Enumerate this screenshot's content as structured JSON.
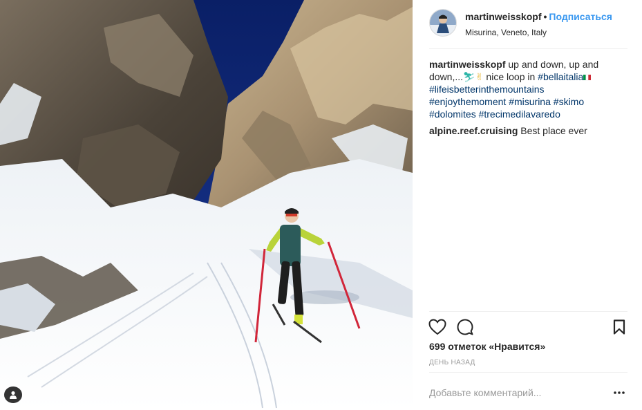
{
  "post": {
    "author": "martinweisskopf",
    "separator": "•",
    "follow_label": "Подписаться",
    "location": "Misurina, Veneto, Italy"
  },
  "caption": {
    "username": "martinweisskopf",
    "text_1": " up and down, up and down,...",
    "emoji_1": "⛷",
    "emoji_2": "✌",
    "text_2": " nice loop in ",
    "hashtags": [
      "#bellaitalia",
      "#lifeisbetterinthemountains",
      "#enjoythemoment",
      "#misurina",
      "#skimo",
      "#dolomites",
      "#trecimedilavaredo"
    ],
    "flag_emoji": "🇮🇹"
  },
  "comment": {
    "username": "alpine.reef.cruising",
    "text": "Best place ever"
  },
  "actions": {
    "like_icon": "heart-icon",
    "comment_icon": "comment-bubble-icon",
    "save_icon": "bookmark-icon"
  },
  "likes_label": "699 отметок «Нравится»",
  "time_label": "ДЕНЬ НАЗАД",
  "comment_input": {
    "placeholder": "Добавьте комментарий..."
  },
  "more_icon": "more-options-icon",
  "photo_badge_icon": "user-tag-icon"
}
